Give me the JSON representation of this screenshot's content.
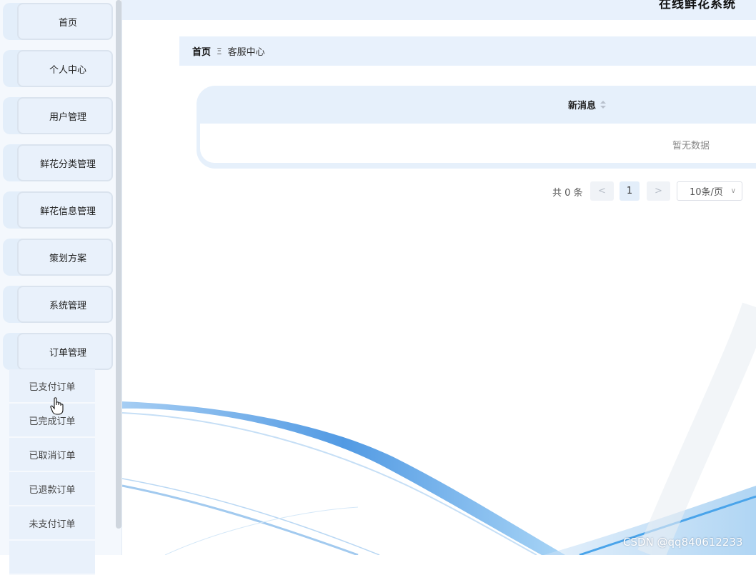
{
  "app": {
    "title": "在线鲜花系统"
  },
  "sidebar": {
    "items": [
      {
        "label": "首页"
      },
      {
        "label": "个人中心"
      },
      {
        "label": "用户管理"
      },
      {
        "label": "鲜花分类管理"
      },
      {
        "label": "鲜花信息管理"
      },
      {
        "label": "策划方案"
      },
      {
        "label": "系统管理"
      },
      {
        "label": "订单管理"
      }
    ],
    "submenu": [
      {
        "label": "已支付订单"
      },
      {
        "label": "已完成订单"
      },
      {
        "label": "已取消订单"
      },
      {
        "label": "已退款订单"
      },
      {
        "label": "未支付订单"
      }
    ]
  },
  "breadcrumb": {
    "home": "首页",
    "separator": "Ξ",
    "current": "客服中心"
  },
  "table": {
    "column": "新消息",
    "empty_text": "暂无数据"
  },
  "pagination": {
    "total": "共 0 条",
    "prev": "<",
    "page": "1",
    "next": ">",
    "page_size": "10条/页"
  },
  "watermark": "CSDN @qq840612233",
  "colors": {
    "accent": "#e8f1fc",
    "wave": "#4a9be8"
  }
}
